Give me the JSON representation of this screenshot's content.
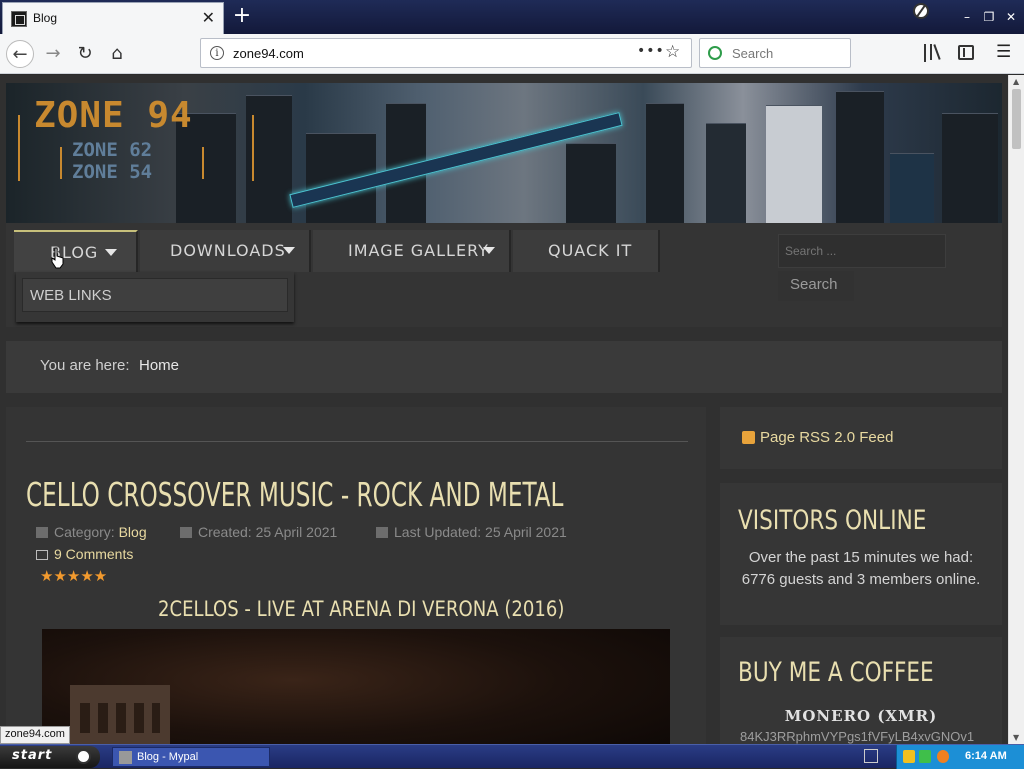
{
  "browser": {
    "tab_title": "Blog",
    "tab_close": "✕",
    "new_tab": "+",
    "url": "zone94.com",
    "page_actions": "•••",
    "search_placeholder": "Search",
    "window_minimize": "–",
    "window_restore": "❐",
    "window_close": "✕"
  },
  "site": {
    "logo_main": "ZONE 94",
    "logo_sub1": "ZONE 62",
    "logo_sub2": "ZONE 54",
    "menu": [
      {
        "label": "BLOG"
      },
      {
        "label": "DOWNLOADS"
      },
      {
        "label": "IMAGE GALLERY"
      },
      {
        "label": "QUACK IT"
      }
    ],
    "submenu_item": "WEB LINKS",
    "search_placeholder": "Search ...",
    "search_button": "Search",
    "breadcrumb_label": "You are here:",
    "breadcrumb_current": "Home"
  },
  "article": {
    "title": "CELLO CROSSOVER MUSIC - ROCK AND METAL",
    "category_label": "Category:",
    "category": "Blog",
    "created": "Created: 25 April 2021",
    "updated": "Last Updated: 25 April 2021",
    "comments": "9 Comments",
    "rating": "★★★★★",
    "video_title": "2CELLOS - LIVE AT ARENA DI VERONA (2016)"
  },
  "sidebar": {
    "rss": "Page RSS 2.0 Feed",
    "visitors_heading": "VISITORS ONLINE",
    "visitors_text": "Over the past 15 minutes we had: 6776 guests and 3 members online.",
    "coffee_heading": "BUY ME A COFFEE",
    "monero_label": "MONERO (XMR)",
    "monero_address": "84KJ3RRphmVYPgs1fVFyLB4xvGNOv1"
  },
  "status_url": "zone94.com",
  "taskbar": {
    "start_label": "start",
    "task_label": "Blog - Mypal",
    "clock": "6:14 AM"
  },
  "colors": {
    "accent_gold": "#e9dfb0",
    "link": "#e8d9a0",
    "rating": "#f29a2e",
    "logo": "#c8892f"
  }
}
